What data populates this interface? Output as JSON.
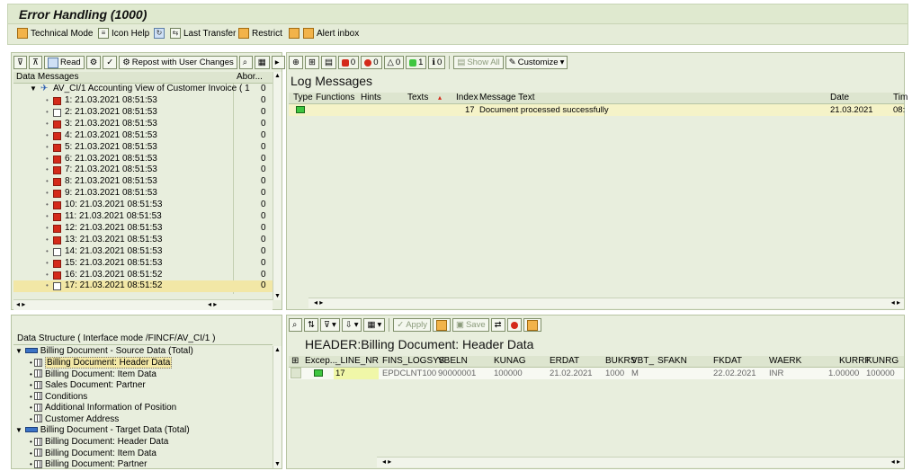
{
  "window": {
    "title": "Error Handling (1000)"
  },
  "appbar": [
    {
      "label": "Technical Mode",
      "icon": "technical-mode-icon"
    },
    {
      "label": "Icon Help",
      "icon": "icon-help-icon"
    },
    {
      "label": "",
      "icon": "refresh-icon"
    },
    {
      "label": "Last Transfer",
      "icon": "last-transfer-icon"
    },
    {
      "label": "Restrict",
      "icon": "restrict-icon"
    },
    {
      "label": "",
      "icon": "service-icon"
    },
    {
      "label": "Alert inbox",
      "icon": "alert-inbox-icon"
    }
  ],
  "data_messages": {
    "toolbar": {
      "read": "Read",
      "repost": "Repost with User Changes"
    },
    "col_name": "Data Messages",
    "col_abort": "Abor...",
    "root": {
      "label": "AV_CI/1 Accounting View of Customer Invoice ( 1",
      "count": "0"
    },
    "items": [
      {
        "label": "1: 21.03.2021 08:51:53",
        "count": "0",
        "status": "error"
      },
      {
        "label": "2: 21.03.2021 08:51:53",
        "count": "0",
        "status": "ok"
      },
      {
        "label": "3: 21.03.2021 08:51:53",
        "count": "0",
        "status": "error"
      },
      {
        "label": "4: 21.03.2021 08:51:53",
        "count": "0",
        "status": "error"
      },
      {
        "label": "5: 21.03.2021 08:51:53",
        "count": "0",
        "status": "error"
      },
      {
        "label": "6: 21.03.2021 08:51:53",
        "count": "0",
        "status": "error"
      },
      {
        "label": "7: 21.03.2021 08:51:53",
        "count": "0",
        "status": "error"
      },
      {
        "label": "8: 21.03.2021 08:51:53",
        "count": "0",
        "status": "error"
      },
      {
        "label": "9: 21.03.2021 08:51:53",
        "count": "0",
        "status": "error"
      },
      {
        "label": "10: 21.03.2021 08:51:53",
        "count": "0",
        "status": "error"
      },
      {
        "label": "11: 21.03.2021 08:51:53",
        "count": "0",
        "status": "error"
      },
      {
        "label": "12: 21.03.2021 08:51:53",
        "count": "0",
        "status": "error"
      },
      {
        "label": "13: 21.03.2021 08:51:53",
        "count": "0",
        "status": "error"
      },
      {
        "label": "14: 21.03.2021 08:51:53",
        "count": "0",
        "status": "ok"
      },
      {
        "label": "15: 21.03.2021 08:51:53",
        "count": "0",
        "status": "error"
      },
      {
        "label": "16: 21.03.2021 08:51:52",
        "count": "0",
        "status": "error"
      },
      {
        "label": "17: 21.03.2021 08:51:52",
        "count": "0",
        "status": "ok",
        "selected": true
      }
    ]
  },
  "log": {
    "toolbar": {
      "c_stop": "0",
      "c_error": "0",
      "c_warning": "0",
      "c_success": "1",
      "c_info": "0",
      "show_all": "Show All",
      "customize": "Customize"
    },
    "title": "Log Messages",
    "columns": {
      "type": "Type",
      "functions": "Functions",
      "hints": "Hints",
      "texts": "Texts",
      "index": "Index",
      "text": "Message Text",
      "date": "Date",
      "time": "Tim"
    },
    "rows": [
      {
        "index": "17",
        "text": "Document processed successfully",
        "date": "21.03.2021",
        "time": "08:"
      }
    ]
  },
  "structure": {
    "title": "Data Structure ( Interface mode /FINCF/AV_CI/1 )",
    "source": {
      "label": "Billing Document - Source Data (Total)",
      "items": [
        "Billing Document: Header Data",
        "Billing Document: Item Data",
        "Sales Document: Partner",
        "Conditions",
        "Additional Information of Position",
        "Customer Address"
      ]
    },
    "target": {
      "label": "Billing Document - Target Data (Total)",
      "items": [
        "Billing Document: Header Data",
        "Billing Document: Item Data",
        "Billing Document: Partner"
      ]
    }
  },
  "detail": {
    "toolbar": {
      "apply": "Apply",
      "save": "Save"
    },
    "title": "HEADER:Billing Document: Header Data",
    "columns": {
      "excep": "Excep...",
      "line_nr": "_LINE_NR",
      "logsys": "FINS_LOGSYS",
      "vbeln": "VBELN",
      "kunag": "KUNAG",
      "erdat": "ERDAT",
      "bukrs": "BUKRS",
      "vbt": "VBT_",
      "sfakn": "SFAKN",
      "fkdat": "FKDAT",
      "waerk": "WAERK",
      "kurrf": "KURRF",
      "kunrg": "KUNRG"
    },
    "row": {
      "line_nr": "17",
      "logsys": "EPDCLNT100",
      "vbeln": "90000001",
      "kunag": "100000",
      "erdat": "21.02.2021",
      "bukrs": "1000",
      "vbt": "M",
      "sfakn": "",
      "fkdat": "22.02.2021",
      "waerk": "INR",
      "kurrf": "1.00000",
      "kunrg": "100000"
    }
  },
  "colors": {
    "pane_bg": "#e8eedd",
    "error_red": "#d42a1a",
    "success_green": "#3fc640",
    "selection": "#f2e7a6",
    "sap_blue": "#3b73c6"
  }
}
